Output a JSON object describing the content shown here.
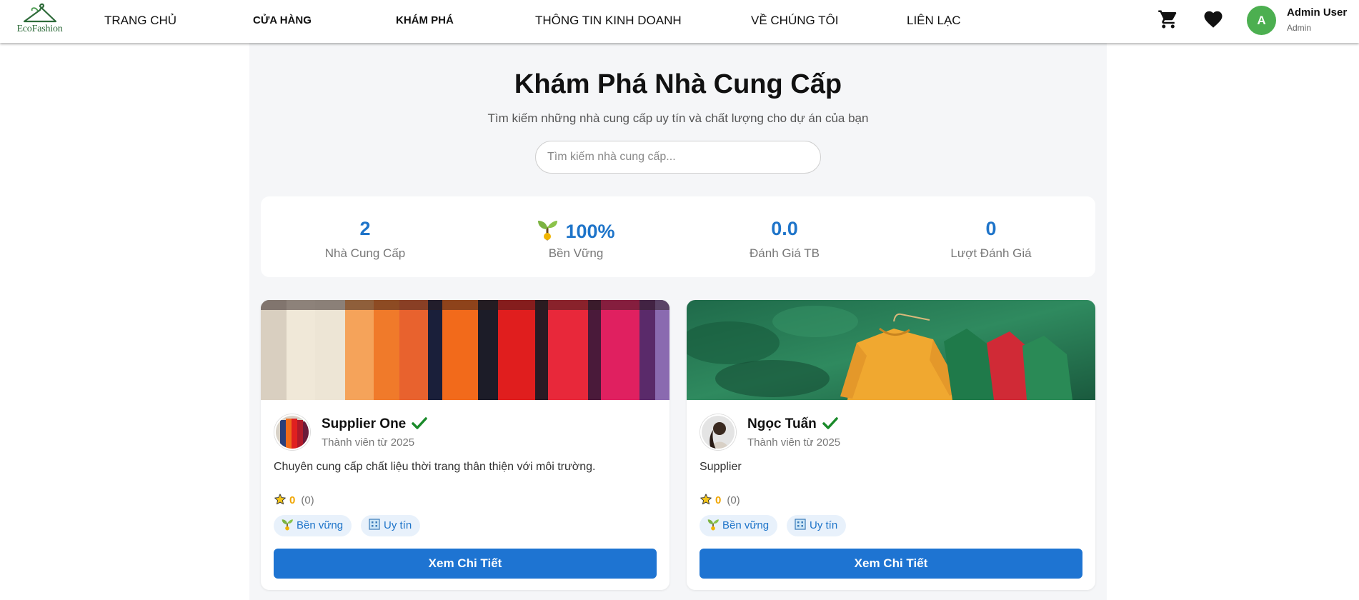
{
  "header": {
    "logo_text": "EcoFashion",
    "nav": [
      "TRANG CHỦ",
      "CỬA HÀNG",
      "KHÁM PHÁ",
      "THÔNG TIN KINH DOANH",
      "VỀ CHÚNG TÔI",
      "LIÊN LẠC"
    ],
    "cart_icon": "cart-icon",
    "wishlist_icon": "heart-icon",
    "user": {
      "initial": "A",
      "name": "Admin User",
      "role": "Admin"
    }
  },
  "main": {
    "title": "Khám Phá Nhà Cung Cấp",
    "subtitle": "Tìm kiếm những nhà cung cấp uy tín và chất lượng cho dự án của bạn",
    "search": {
      "placeholder": "Tìm kiếm nhà cung cấp...",
      "value": ""
    },
    "stats": [
      {
        "value": "2",
        "label": "Nhà Cung Cấp"
      },
      {
        "value": "100%",
        "label": "Bền Vững",
        "icon": "sprout-icon"
      },
      {
        "value": "0.0",
        "label": "Đánh Giá TB"
      },
      {
        "value": "0",
        "label": "Lượt Đánh Giá"
      }
    ],
    "suppliers": [
      {
        "name": "Supplier One",
        "since": "Thành viên từ 2025",
        "description": "Chuyên cung cấp chất liệu thời trang thân thiện với môi trường.",
        "rating": "0",
        "review_count": "(0)",
        "tags": [
          "Bền vững",
          "Uy tín"
        ],
        "button": "Xem Chi Tiết"
      },
      {
        "name": "Ngọc Tuấn",
        "since": "Thành viên từ 2025",
        "description": "Supplier",
        "rating": "0",
        "review_count": "(0)",
        "tags": [
          "Bền vững",
          "Uy tín"
        ],
        "button": "Xem Chi Tiết"
      }
    ]
  },
  "colors": {
    "accent": "#1e74c9",
    "button": "#1e74d2",
    "avatar": "#4caf50",
    "rating": "#f0a500",
    "tag_bg": "#e8f1fb"
  }
}
